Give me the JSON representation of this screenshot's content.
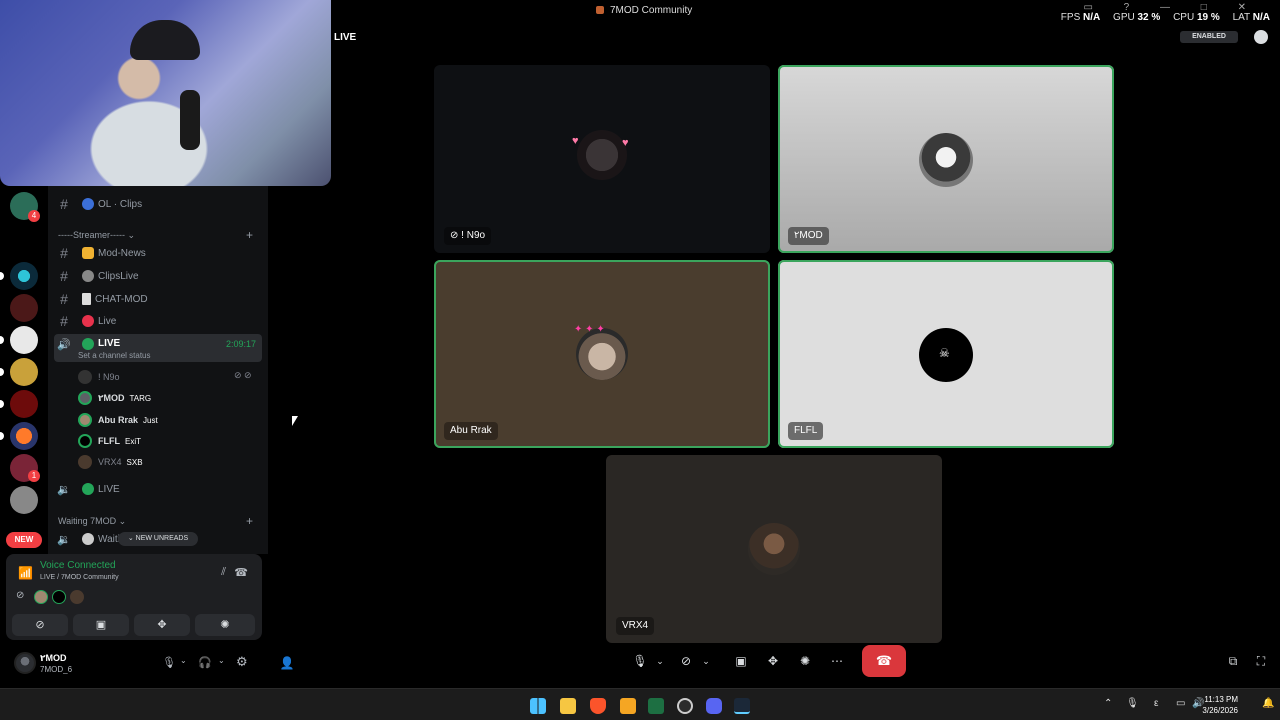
{
  "window": {
    "title": "7MOD Community"
  },
  "stats": {
    "fps_label": "FPS",
    "fps": "N/A",
    "gpu_label": "GPU",
    "gpu": "32 %",
    "cpu_label": "CPU",
    "cpu": "19 %",
    "lat_label": "LAT",
    "lat": "N/A"
  },
  "header": {
    "channel": "LIVE",
    "enabled": "ENABLED"
  },
  "rail": {
    "new_label": "NEW",
    "badge1": "4",
    "badge2": "1"
  },
  "channels": {
    "top": "OL · Clips",
    "category_streamer": "-----Streamer----- ⌄",
    "items": [
      {
        "name": "Mod-News"
      },
      {
        "name": "ClipsLive"
      },
      {
        "name": "CHAT-MOD"
      },
      {
        "name": "Live"
      }
    ],
    "active": {
      "name": "LIVE",
      "timer": "2:09:17",
      "status": "Set a channel status"
    },
    "members": [
      {
        "name": "! N9o",
        "tag": ""
      },
      {
        "name": "٢MOD",
        "tag": "TARG"
      },
      {
        "name": "Abu Rrak",
        "tag": "Just"
      },
      {
        "name": "FLFL",
        "tag": "ExiT"
      },
      {
        "name": "VRX4",
        "tag": "SXB"
      }
    ],
    "second_live": "LIVE",
    "category_waiting": "Waiting 7MOD ⌄",
    "waiting": "Waiti",
    "new_unreads": "NEW UNREADS"
  },
  "voice": {
    "title": "Voice Connected",
    "sub": "LIVE / 7MOD Community"
  },
  "user": {
    "name": "٢MOD",
    "sub": "7MOD_6"
  },
  "tiles": [
    {
      "label": "! N9o"
    },
    {
      "label": "٢MOD"
    },
    {
      "label": "Abu Rrak"
    },
    {
      "label": "FLFL"
    },
    {
      "label": "VRX4"
    }
  ],
  "clock": {
    "time": "11:13 PM",
    "date": "3/26/2026"
  },
  "colors": {
    "speaking": "#3ba55d",
    "hangup": "#da373c",
    "connected": "#23a559"
  }
}
